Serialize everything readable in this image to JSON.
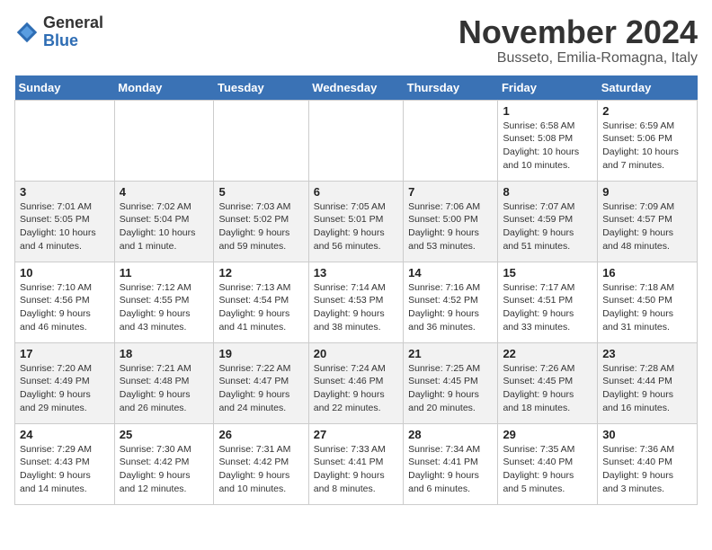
{
  "header": {
    "logo_general": "General",
    "logo_blue": "Blue",
    "month_title": "November 2024",
    "location": "Busseto, Emilia-Romagna, Italy"
  },
  "weekdays": [
    "Sunday",
    "Monday",
    "Tuesday",
    "Wednesday",
    "Thursday",
    "Friday",
    "Saturday"
  ],
  "weeks": [
    [
      {
        "day": "",
        "info": ""
      },
      {
        "day": "",
        "info": ""
      },
      {
        "day": "",
        "info": ""
      },
      {
        "day": "",
        "info": ""
      },
      {
        "day": "",
        "info": ""
      },
      {
        "day": "1",
        "info": "Sunrise: 6:58 AM\nSunset: 5:08 PM\nDaylight: 10 hours\nand 10 minutes."
      },
      {
        "day": "2",
        "info": "Sunrise: 6:59 AM\nSunset: 5:06 PM\nDaylight: 10 hours\nand 7 minutes."
      }
    ],
    [
      {
        "day": "3",
        "info": "Sunrise: 7:01 AM\nSunset: 5:05 PM\nDaylight: 10 hours\nand 4 minutes."
      },
      {
        "day": "4",
        "info": "Sunrise: 7:02 AM\nSunset: 5:04 PM\nDaylight: 10 hours\nand 1 minute."
      },
      {
        "day": "5",
        "info": "Sunrise: 7:03 AM\nSunset: 5:02 PM\nDaylight: 9 hours\nand 59 minutes."
      },
      {
        "day": "6",
        "info": "Sunrise: 7:05 AM\nSunset: 5:01 PM\nDaylight: 9 hours\nand 56 minutes."
      },
      {
        "day": "7",
        "info": "Sunrise: 7:06 AM\nSunset: 5:00 PM\nDaylight: 9 hours\nand 53 minutes."
      },
      {
        "day": "8",
        "info": "Sunrise: 7:07 AM\nSunset: 4:59 PM\nDaylight: 9 hours\nand 51 minutes."
      },
      {
        "day": "9",
        "info": "Sunrise: 7:09 AM\nSunset: 4:57 PM\nDaylight: 9 hours\nand 48 minutes."
      }
    ],
    [
      {
        "day": "10",
        "info": "Sunrise: 7:10 AM\nSunset: 4:56 PM\nDaylight: 9 hours\nand 46 minutes."
      },
      {
        "day": "11",
        "info": "Sunrise: 7:12 AM\nSunset: 4:55 PM\nDaylight: 9 hours\nand 43 minutes."
      },
      {
        "day": "12",
        "info": "Sunrise: 7:13 AM\nSunset: 4:54 PM\nDaylight: 9 hours\nand 41 minutes."
      },
      {
        "day": "13",
        "info": "Sunrise: 7:14 AM\nSunset: 4:53 PM\nDaylight: 9 hours\nand 38 minutes."
      },
      {
        "day": "14",
        "info": "Sunrise: 7:16 AM\nSunset: 4:52 PM\nDaylight: 9 hours\nand 36 minutes."
      },
      {
        "day": "15",
        "info": "Sunrise: 7:17 AM\nSunset: 4:51 PM\nDaylight: 9 hours\nand 33 minutes."
      },
      {
        "day": "16",
        "info": "Sunrise: 7:18 AM\nSunset: 4:50 PM\nDaylight: 9 hours\nand 31 minutes."
      }
    ],
    [
      {
        "day": "17",
        "info": "Sunrise: 7:20 AM\nSunset: 4:49 PM\nDaylight: 9 hours\nand 29 minutes."
      },
      {
        "day": "18",
        "info": "Sunrise: 7:21 AM\nSunset: 4:48 PM\nDaylight: 9 hours\nand 26 minutes."
      },
      {
        "day": "19",
        "info": "Sunrise: 7:22 AM\nSunset: 4:47 PM\nDaylight: 9 hours\nand 24 minutes."
      },
      {
        "day": "20",
        "info": "Sunrise: 7:24 AM\nSunset: 4:46 PM\nDaylight: 9 hours\nand 22 minutes."
      },
      {
        "day": "21",
        "info": "Sunrise: 7:25 AM\nSunset: 4:45 PM\nDaylight: 9 hours\nand 20 minutes."
      },
      {
        "day": "22",
        "info": "Sunrise: 7:26 AM\nSunset: 4:45 PM\nDaylight: 9 hours\nand 18 minutes."
      },
      {
        "day": "23",
        "info": "Sunrise: 7:28 AM\nSunset: 4:44 PM\nDaylight: 9 hours\nand 16 minutes."
      }
    ],
    [
      {
        "day": "24",
        "info": "Sunrise: 7:29 AM\nSunset: 4:43 PM\nDaylight: 9 hours\nand 14 minutes."
      },
      {
        "day": "25",
        "info": "Sunrise: 7:30 AM\nSunset: 4:42 PM\nDaylight: 9 hours\nand 12 minutes."
      },
      {
        "day": "26",
        "info": "Sunrise: 7:31 AM\nSunset: 4:42 PM\nDaylight: 9 hours\nand 10 minutes."
      },
      {
        "day": "27",
        "info": "Sunrise: 7:33 AM\nSunset: 4:41 PM\nDaylight: 9 hours\nand 8 minutes."
      },
      {
        "day": "28",
        "info": "Sunrise: 7:34 AM\nSunset: 4:41 PM\nDaylight: 9 hours\nand 6 minutes."
      },
      {
        "day": "29",
        "info": "Sunrise: 7:35 AM\nSunset: 4:40 PM\nDaylight: 9 hours\nand 5 minutes."
      },
      {
        "day": "30",
        "info": "Sunrise: 7:36 AM\nSunset: 4:40 PM\nDaylight: 9 hours\nand 3 minutes."
      }
    ]
  ]
}
